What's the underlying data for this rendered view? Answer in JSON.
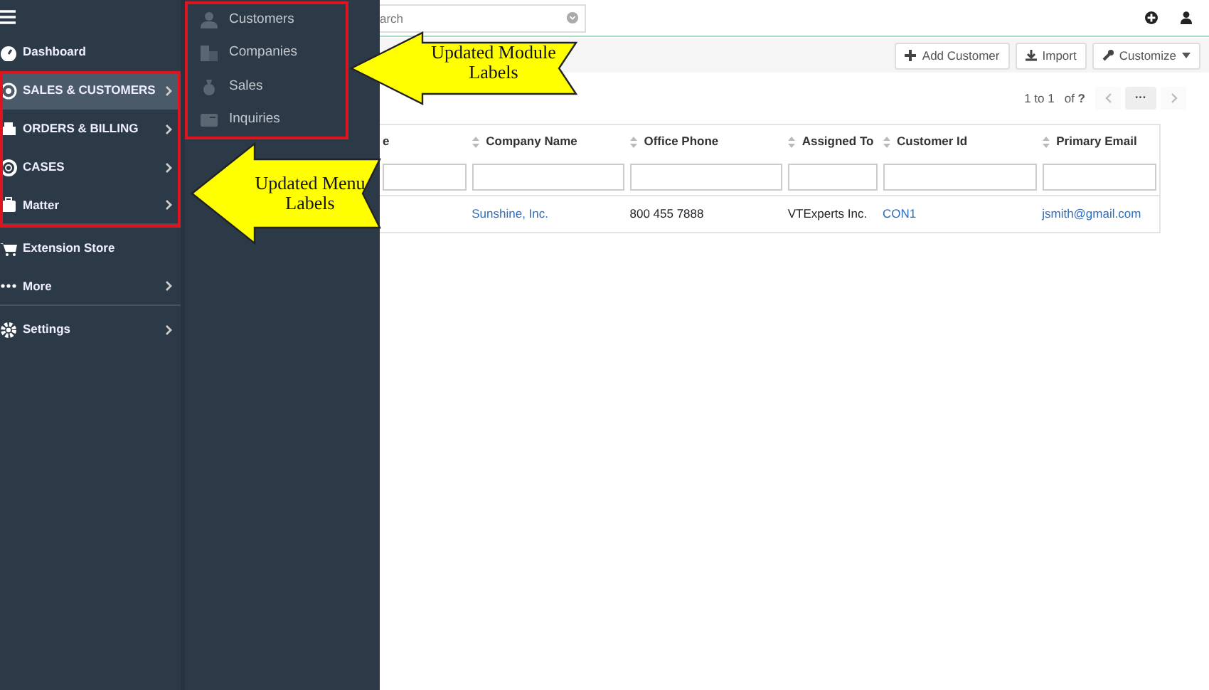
{
  "sidebar": {
    "items": [
      {
        "kind": "dashboard",
        "label": "Dashboard",
        "selected": false,
        "has_submenu": false,
        "divider_after": false
      },
      {
        "kind": "sales",
        "label": "SALES & CUSTOMERS",
        "selected": true,
        "has_submenu": true,
        "divider_after": false
      },
      {
        "kind": "orders",
        "label": "ORDERS & BILLING",
        "selected": false,
        "has_submenu": true,
        "divider_after": false
      },
      {
        "kind": "cases",
        "label": "CASES",
        "selected": false,
        "has_submenu": true,
        "divider_after": false
      },
      {
        "kind": "matter",
        "label": "Matter",
        "selected": false,
        "has_submenu": true,
        "divider_after": true
      },
      {
        "kind": "store",
        "label": "Extension Store",
        "selected": false,
        "has_submenu": false,
        "divider_after": false
      },
      {
        "kind": "more",
        "label": "More",
        "selected": false,
        "has_submenu": true,
        "divider_after": true
      },
      {
        "kind": "settings",
        "label": "Settings",
        "selected": false,
        "has_submenu": true,
        "divider_after": false
      }
    ]
  },
  "submenu": {
    "items": [
      {
        "kind": "person",
        "label": "Customers"
      },
      {
        "kind": "building",
        "label": "Companies"
      },
      {
        "kind": "bag",
        "label": "Sales"
      },
      {
        "kind": "card",
        "label": "Inquiries"
      }
    ]
  },
  "search": {
    "placeholder": "arch"
  },
  "toolbar": {
    "buttons": [
      {
        "kind": "plus",
        "label": "Add Customer",
        "dropdown": false
      },
      {
        "kind": "download",
        "label": "Import",
        "dropdown": false
      },
      {
        "kind": "wrench",
        "label": "Customize",
        "dropdown": true
      }
    ]
  },
  "pagination": {
    "range": "1 to 1",
    "of": "of",
    "total": "?",
    "more": "···"
  },
  "table": {
    "columns": [
      "e",
      "Company Name",
      "Office Phone",
      "Assigned To",
      "Customer Id",
      "Primary Email"
    ],
    "rows": [
      {
        "cells": [
          {
            "text": ""
          },
          {
            "text": "Sunshine, Inc.",
            "link": true
          },
          {
            "text": "800 455 7888",
            "link": false
          },
          {
            "text": "VTExperts Inc.",
            "link": false
          },
          {
            "text": "CON1",
            "link": true
          },
          {
            "text": "jsmith@gmail.com",
            "link": true
          }
        ]
      }
    ]
  },
  "annotations": [
    {
      "text": "Updated Module Labels"
    },
    {
      "text": "Updated Menu Labels"
    }
  ]
}
